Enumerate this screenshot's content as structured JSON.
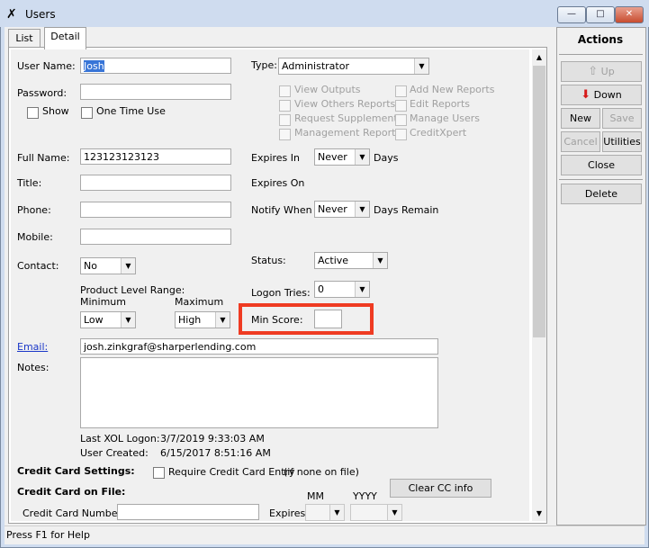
{
  "window": {
    "title": "Users",
    "minimize": "—",
    "maximize": "□",
    "close": "✕"
  },
  "tabs": [
    {
      "label": "List"
    },
    {
      "label": "Detail"
    }
  ],
  "form": {
    "user_name_label": "User Name:",
    "user_name": "Josh",
    "password_label": "Password:",
    "password": "",
    "show_label": "Show",
    "one_time_use_label": "One Time Use",
    "type_label": "Type:",
    "type_value": "Administrator",
    "permissions": [
      "View Outputs",
      "View Others Reports",
      "Request Supplements",
      "Management Reports",
      "Add New Reports",
      "Edit Reports",
      "Manage Users",
      "CreditXpert"
    ],
    "full_name_label": "Full Name:",
    "full_name": "123123123123",
    "title_label": "Title:",
    "title": "",
    "phone_label": "Phone:",
    "phone": "",
    "mobile_label": "Mobile:",
    "mobile": "",
    "contact_label": "Contact:",
    "contact_value": "No",
    "expires_in_label": "Expires In",
    "expires_in_value": "Never",
    "days_label": "Days",
    "expires_on_label": "Expires On",
    "notify_when_label": "Notify When",
    "notify_when_value": "Never",
    "days_remain_label": "Days Remain",
    "status_label": "Status:",
    "status_value": "Active",
    "product_range_label": "Product Level Range:",
    "minimum_label": "Minimum",
    "minimum_value": "Low",
    "maximum_label": "Maximum",
    "maximum_value": "High",
    "logon_tries_label": "Logon Tries:",
    "logon_tries_value": "0",
    "min_score_label": "Min Score:",
    "min_score_value": "",
    "email_label": "Email:",
    "email": "josh.zinkgraf@sharperlending.com",
    "notes_label": "Notes:",
    "notes": "",
    "last_logon_label": "Last XOL Logon:",
    "last_logon": "3/7/2019 9:33:03 AM",
    "user_created_label": "User Created:",
    "user_created": "6/15/2017 8:51:16 AM",
    "cc_settings_label": "Credit Card Settings:",
    "require_cc_label": "Require Credit Card Entry",
    "require_cc_note": "(if none on file)",
    "cc_on_file_label": "Credit Card on File:",
    "mm_label": "MM",
    "yyyy_label": "YYYY",
    "clear_cc_label": "Clear CC info",
    "cc_number_label": "Credit Card Number:",
    "expires_label": "Expires"
  },
  "actions": {
    "header": "Actions",
    "up": "Up",
    "down": "Down",
    "new": "New",
    "save": "Save",
    "cancel": "Cancel",
    "utilities": "Utilities",
    "close": "Close",
    "delete": "Delete"
  },
  "status_bar": {
    "text": "Press F1 for Help"
  },
  "colors": {
    "highlight": "#ef3b22",
    "link": "#1a37c8",
    "down_arrow": "#d61a1a",
    "selection": "#3875d7"
  }
}
